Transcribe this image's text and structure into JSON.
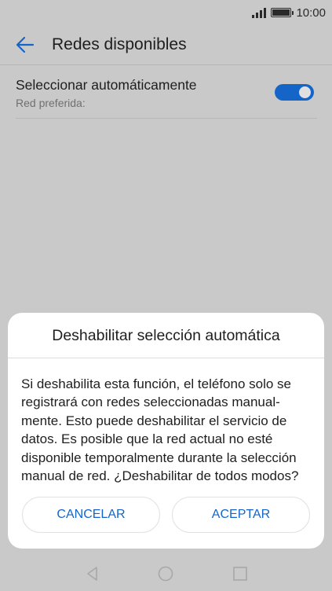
{
  "status_bar": {
    "time": "10:00",
    "icons": [
      "signal-icon",
      "battery-icon"
    ]
  },
  "toolbar": {
    "back_icon": "back-arrow-icon",
    "title": "Redes disponibles"
  },
  "setting": {
    "title": "Seleccionar automáticamente",
    "subtitle": "Red preferida:",
    "toggle_on": true
  },
  "dialog": {
    "title": "Deshabilitar selección automática",
    "message_lines": [
      "Si deshabilita esta función, el teléfono solo se",
      "registrará con redes seleccionadas manual-",
      "mente. Esto puede deshabilitar el servicio de",
      "datos. Es posible que la red actual no esté",
      "disponible temporalmente durante la selección",
      "manual de red. ¿Deshabilitar de todos modos?"
    ],
    "cancel_label": "CANCELAR",
    "accept_label": "ACEPTAR"
  },
  "nav_bar": {
    "icons": [
      "back-triangle-icon",
      "home-circle-icon",
      "recents-square-icon"
    ]
  },
  "colors": {
    "accent": "#1565c8",
    "scrim_background": "#c9c9c9",
    "dialog_background": "#ffffff"
  }
}
